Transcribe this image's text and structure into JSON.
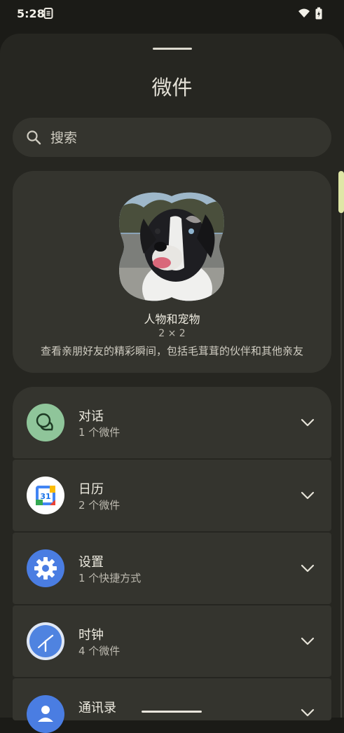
{
  "status_bar": {
    "time": "5:28"
  },
  "header": {
    "title": "微件"
  },
  "search": {
    "placeholder": "搜索"
  },
  "featured": {
    "name": "人物和宠物",
    "size": "2 × 2",
    "description": "查看亲朋好友的精彩瞬间，包括毛茸茸的伙伴和其他亲友"
  },
  "apps": [
    {
      "title": "对话",
      "subtitle": "1 个微件",
      "icon": "conversations-icon"
    },
    {
      "title": "日历",
      "subtitle": "2 个微件",
      "icon": "calendar-icon",
      "icon_text": "31"
    },
    {
      "title": "设置",
      "subtitle": "1 个快捷方式",
      "icon": "settings-gear-icon"
    },
    {
      "title": "时钟",
      "subtitle": "4 个微件",
      "icon": "clock-icon"
    },
    {
      "title": "通讯录",
      "subtitle": "",
      "icon": "contacts-icon"
    }
  ],
  "colors": {
    "background": "#1b1b17",
    "sheet": "#262621",
    "card": "#34342e",
    "accent_scroll": "#dfe6a6"
  }
}
